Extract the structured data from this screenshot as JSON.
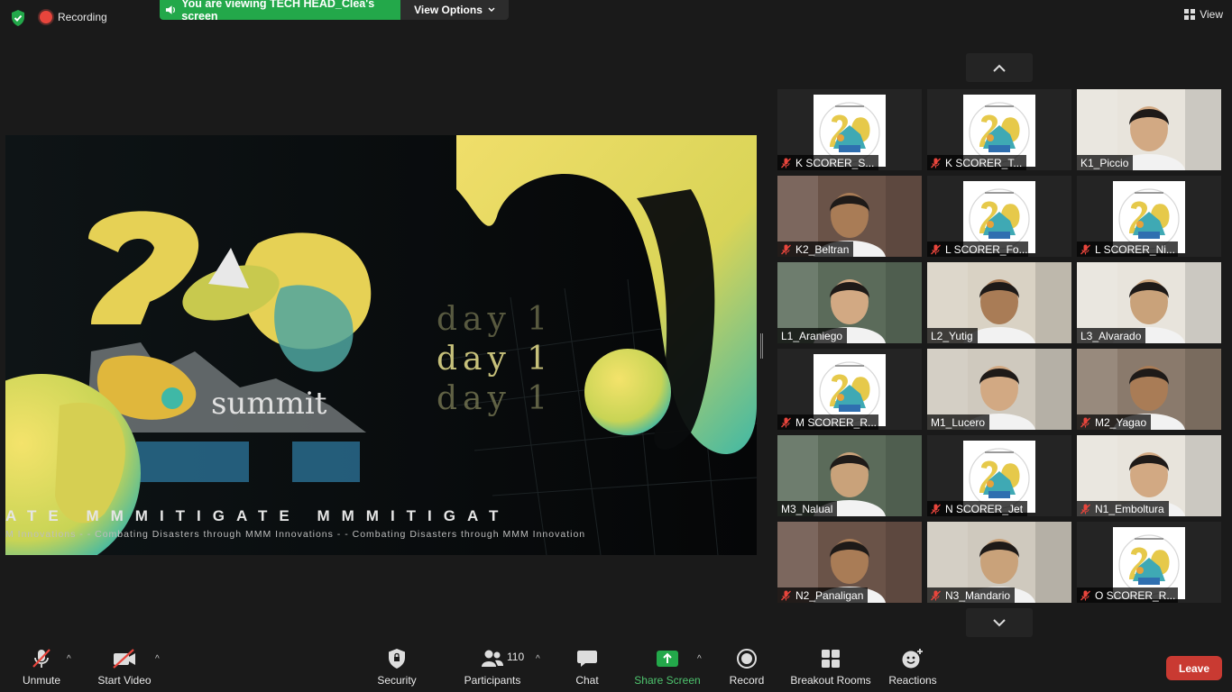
{
  "top": {
    "recording": "Recording",
    "viewing": "You are viewing TECH HEAD_Clea's screen",
    "view_options": "View Options",
    "view": "View"
  },
  "shared_screen": {
    "day_lines": [
      "day 1",
      "day 1",
      "day 1"
    ],
    "summit": "summit",
    "marquee": "ATE MMMITIGATE MMMITIGAT",
    "tagline": "M Innovations -      - Combating Disasters through MMM Innovations -      - Combating Disasters through MMM Innovation",
    "accent_yellow": "#e8d34f",
    "accent_teal": "#3fb8a6"
  },
  "gallery": {
    "participants": [
      {
        "name": "K SCORER_S...",
        "muted": true,
        "kind": "logo"
      },
      {
        "name": "K SCORER_T...",
        "muted": true,
        "kind": "logo"
      },
      {
        "name": "K1_Piccio",
        "muted": false,
        "kind": "video"
      },
      {
        "name": "K2_Beltran",
        "muted": true,
        "kind": "video"
      },
      {
        "name": "L SCORER_Fo...",
        "muted": true,
        "kind": "logo"
      },
      {
        "name": "L SCORER_Ni...",
        "muted": true,
        "kind": "logo"
      },
      {
        "name": "L1_Araniego",
        "muted": false,
        "kind": "video"
      },
      {
        "name": "L2_Yutig",
        "muted": false,
        "kind": "video"
      },
      {
        "name": "L3_Alvarado",
        "muted": false,
        "kind": "video"
      },
      {
        "name": "M SCORER_R...",
        "muted": true,
        "kind": "logo"
      },
      {
        "name": "M1_Lucero",
        "muted": false,
        "kind": "video"
      },
      {
        "name": "M2_Yagao",
        "muted": true,
        "kind": "video"
      },
      {
        "name": "M3_Nalual",
        "muted": false,
        "kind": "video"
      },
      {
        "name": "N SCORER_Jet",
        "muted": true,
        "kind": "logo"
      },
      {
        "name": "N1_Emboltura",
        "muted": true,
        "kind": "video"
      },
      {
        "name": "N2_Panaligan",
        "muted": true,
        "kind": "video"
      },
      {
        "name": "N3_Mandario",
        "muted": true,
        "kind": "video"
      },
      {
        "name": "O SCORER_R...",
        "muted": true,
        "kind": "logo"
      }
    ]
  },
  "toolbar": {
    "unmute": "Unmute",
    "start_video": "Start Video",
    "security": "Security",
    "participants": "Participants",
    "participants_count": "110",
    "chat": "Chat",
    "share_screen": "Share Screen",
    "record": "Record",
    "breakout_rooms": "Breakout Rooms",
    "reactions": "Reactions",
    "leave": "Leave"
  },
  "colors": {
    "green": "#23a84a",
    "red": "#c93a32",
    "bg": "#1a1a1a"
  }
}
